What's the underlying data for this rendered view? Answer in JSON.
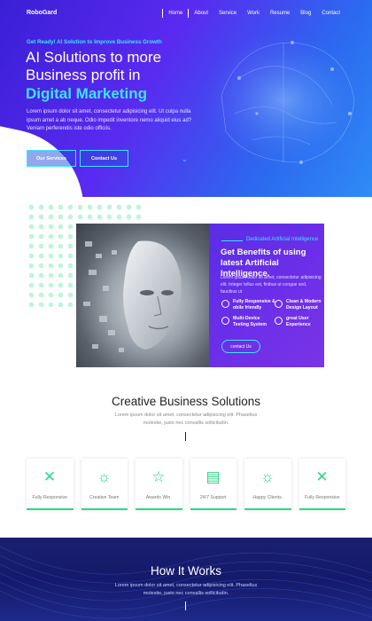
{
  "nav": {
    "logo": "RoboGard",
    "items": [
      "Home",
      "About",
      "Service",
      "Work",
      "Resume",
      "Blog",
      "Contact"
    ]
  },
  "hero": {
    "eyebrow": "Get Ready! AI Solution to Improve Business Growth",
    "title": "AI Solutions to more Business profit in",
    "title_highlight": "Digital Marketing",
    "text": "Lorem ipsum dolor sit amet, consectetur adipisicing elit. Ut culpa nulla ipsum amet a ab neque. Odio impedit inventore nemo aliquid eius ad? Veniam perferendis iste odio officiis.",
    "buttons": [
      "Our Services",
      "Contact Us"
    ]
  },
  "feature": {
    "eyebrow": "Dedicated Artificial Intelligence",
    "title": "Get Benefits of using latest Artificial Intelligence.",
    "text": "Lorem ipsum dolor sit amet, consectetur adipisicing elit. Integer tellus est, finibus ut congue sed, faucibus ut",
    "items": [
      "Fully Responsive & obile friendly",
      "Clean & Modern Design Layout",
      "Multi-Device Testing System",
      "great User Experience"
    ],
    "button": "contact Us"
  },
  "creative": {
    "title": "Creative Business Solutions",
    "subtitle": "Lorem ipsum dolor sit amet, consectetur adipisicing elit. Phasellus molestie, justo nec convallis sollicitudin.",
    "cards": [
      {
        "label": "Fully Responsive",
        "icon": "tools-icon"
      },
      {
        "label": "Creative Team",
        "icon": "lightbulb-icon"
      },
      {
        "label": "Awards Win.",
        "icon": "star-icon"
      },
      {
        "label": "24/7 Support",
        "icon": "document-icon"
      },
      {
        "label": "Happy Clients.",
        "icon": "lightbulb-icon"
      },
      {
        "label": "Fully Responsive",
        "icon": "tools-icon"
      }
    ]
  },
  "how": {
    "title": "How It Works",
    "subtitle": "Lorem ipsum dolor sit amet, consectetur adipisicing elit. Phasellus molestie, justo nec convallis sollicitudin."
  },
  "colors": {
    "accent": "#39e6ff",
    "green": "#2fd68a",
    "purple": "#6b2ee8"
  }
}
